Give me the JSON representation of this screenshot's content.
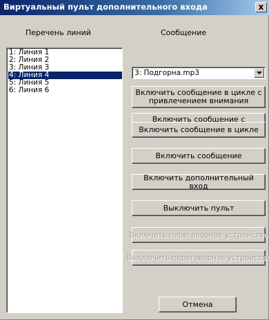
{
  "window": {
    "title": "Виртуальный пульт дополнительного входа",
    "close_label": "x"
  },
  "labels": {
    "lines": "Перечень линий",
    "message": "Сообщение"
  },
  "lines_list": [
    {
      "label": "1: Линия 1",
      "selected": false
    },
    {
      "label": "2: Линия 2",
      "selected": false
    },
    {
      "label": "3: Линия 3",
      "selected": false
    },
    {
      "label": "4: Линия 4",
      "selected": true
    },
    {
      "label": "5: Линия 5",
      "selected": false
    },
    {
      "label": "6: Линия 6",
      "selected": false
    }
  ],
  "message_select": {
    "value": "3: Подгорна.mp3"
  },
  "buttons": {
    "loop_attention": "Включить сообщение в цикле с привлечением внимания",
    "attention": "Включить сообщение с привлечением внимания",
    "loop": "Включить сообщение в цикле",
    "enable_message": "Включить сообщение",
    "enable_extra_input": "Включить дополнительный вход",
    "disable_console": "Выключить пульт",
    "enable_intercom": "Включить переговорное устройство",
    "disable_intercom": "Выключить переговорное устройство",
    "cancel": "Отмена"
  }
}
